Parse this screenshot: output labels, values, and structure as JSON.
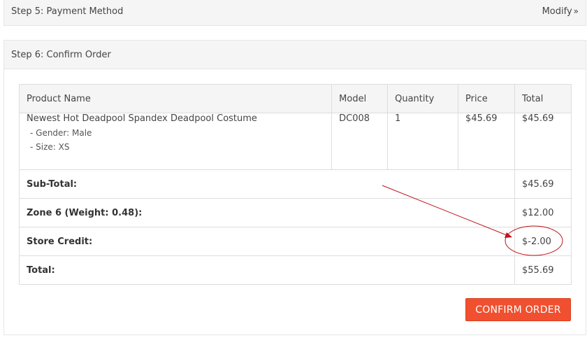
{
  "step5": {
    "title": "Step 5: Payment Method",
    "modify_label": "Modify",
    "modify_chevron": "»"
  },
  "step6": {
    "title": "Step 6: Confirm Order"
  },
  "table": {
    "headers": {
      "product": "Product Name",
      "model": "Model",
      "quantity": "Quantity",
      "price": "Price",
      "total": "Total"
    },
    "item": {
      "name": "Newest Hot Deadpool Spandex Deadpool Costume",
      "options": [
        "- Gender: Male",
        "- Size: XS"
      ],
      "model": "DC008",
      "quantity": "1",
      "price": "$45.69",
      "total": "$45.69"
    },
    "totals": [
      {
        "label": "Sub-Total:",
        "value": "$45.69"
      },
      {
        "label": "Zone 6 (Weight: 0.48):",
        "value": "$12.00"
      },
      {
        "label": "Store Credit:",
        "value": "$-2.00"
      },
      {
        "label": "Total:",
        "value": "$55.69"
      }
    ]
  },
  "confirm_button": {
    "label": "CONFIRM ORDER"
  },
  "annotation": {
    "color": "#c0141c"
  }
}
